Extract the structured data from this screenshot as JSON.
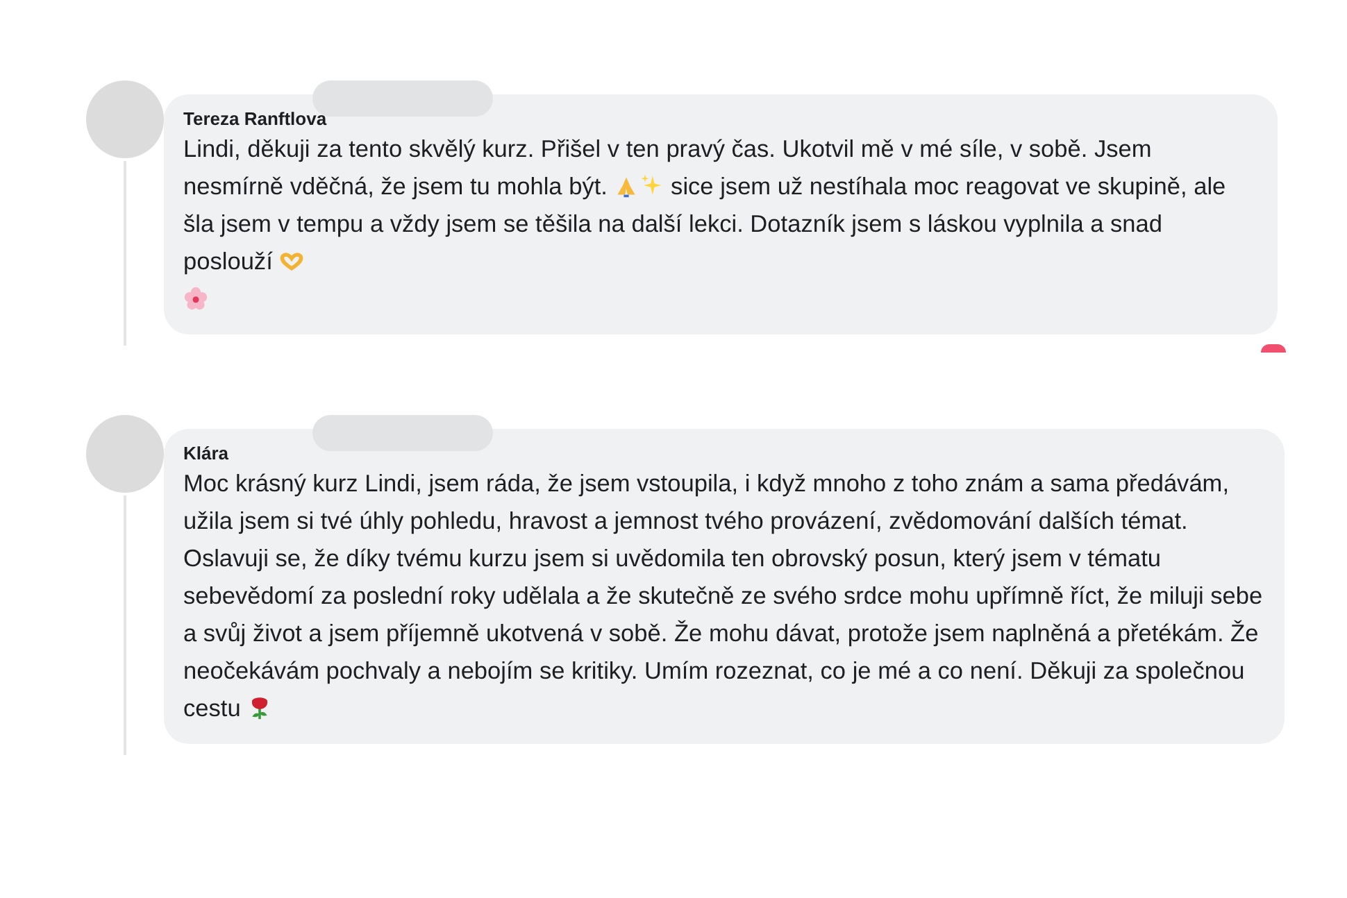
{
  "comments": [
    {
      "author": "Tereza Ranftlova",
      "name_redacted": true,
      "reaction": true,
      "body": [
        {
          "kind": "text",
          "text": "Lindi, děkuji za tento skvělý kurz. Přišel v ten pravý čas. Ukotvil mě v mé síle, v sobě. Jsem nesmírně vděčná, že jsem tu mohla být. "
        },
        {
          "kind": "pray"
        },
        {
          "kind": "sparkles"
        },
        {
          "kind": "text",
          "text": " sice jsem už nestíhala moc reagovat ve skupině, ale šla jsem v tempu a vždy jsem se těšila na další lekci. Dotazník jsem s láskou vyplnila a snad poslouží "
        },
        {
          "kind": "heart-hands"
        },
        {
          "kind": "break"
        },
        {
          "kind": "flower"
        }
      ]
    },
    {
      "author": "Klára",
      "name_redacted": true,
      "body": [
        {
          "kind": "text",
          "text": "Moc krásný kurz Lindi, jsem ráda, že jsem vstoupila, i když mnoho z toho znám a sama předávám, užila jsem si tvé úhly pohledu, hravost a jemnost tvého provázení, zvědomování dalších témat. Oslavuji se, že díky tvému kurzu jsem si uvědomila ten obrovský posun, který jsem v tématu sebevědomí za poslední roky udělala a že skutečně ze svého srdce mohu upřímně říct, že miluji sebe a svůj život a jsem příjemně ukotvená v sobě. Že mohu dávat, protože jsem naplněná a přetékám. Že neočekávám pochvaly a nebojím se kritiky. Umím rozeznat, co je mé a co není. Děkuji za společnou cestu "
        },
        {
          "kind": "rose"
        }
      ]
    }
  ]
}
